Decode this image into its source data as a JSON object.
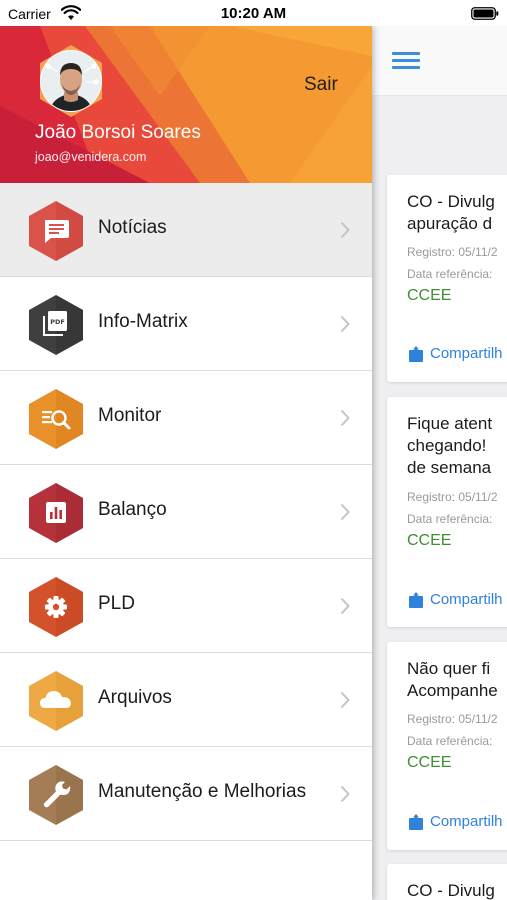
{
  "status_bar": {
    "carrier": "Carrier",
    "time": "10:20 AM",
    "wifi_icon": "wifi-icon",
    "battery_icon": "battery-icon"
  },
  "header": {
    "logout_label": "Sair",
    "user_name": "João Borsoi Soares",
    "user_email": "joao@venidera.com",
    "colors": {
      "orange": "#f7a033",
      "red": "#e53935",
      "dark_red": "#c62828"
    }
  },
  "menu": {
    "items": [
      {
        "label": "Notícias",
        "icon": "news-icon",
        "color": "#d9534a",
        "active": true
      },
      {
        "label": "Info-Matrix",
        "icon": "pdf-icon",
        "color": "#3f3f3f",
        "active": false
      },
      {
        "label": "Monitor",
        "icon": "monitor-search-icon",
        "color": "#e8902a",
        "active": false
      },
      {
        "label": "Balanço",
        "icon": "bar-chart-icon",
        "color": "#b5323b",
        "active": false
      },
      {
        "label": "PLD",
        "icon": "gear-icon",
        "color": "#d4522b",
        "active": false
      },
      {
        "label": "Arquivos",
        "icon": "cloud-icon",
        "color": "#eea944",
        "active": false
      },
      {
        "label": "Manutenção e Melhorias",
        "icon": "wrench-icon",
        "color": "#a47c55",
        "active": false
      }
    ]
  },
  "content": {
    "menu_icon": "hamburger-icon",
    "cards": [
      {
        "title_lines": [
          "CO - Divulg",
          "apuração d"
        ],
        "registro": "Registro: 05/11/2",
        "data_ref": "Data referência:",
        "source": "CCEE",
        "share_label": "Compartilh"
      },
      {
        "title_lines": [
          "Fique atent",
          "chegando! ",
          "de semana"
        ],
        "registro": "Registro: 05/11/2",
        "data_ref": "Data referência:",
        "source": "CCEE",
        "share_label": "Compartilh"
      },
      {
        "title_lines": [
          "Não quer fi",
          "Acompanhe"
        ],
        "registro": "Registro: 05/11/2",
        "data_ref": "Data referência:",
        "source": "CCEE",
        "share_label": "Compartilh"
      },
      {
        "title_lines": [
          "CO - Divulg"
        ]
      }
    ]
  }
}
